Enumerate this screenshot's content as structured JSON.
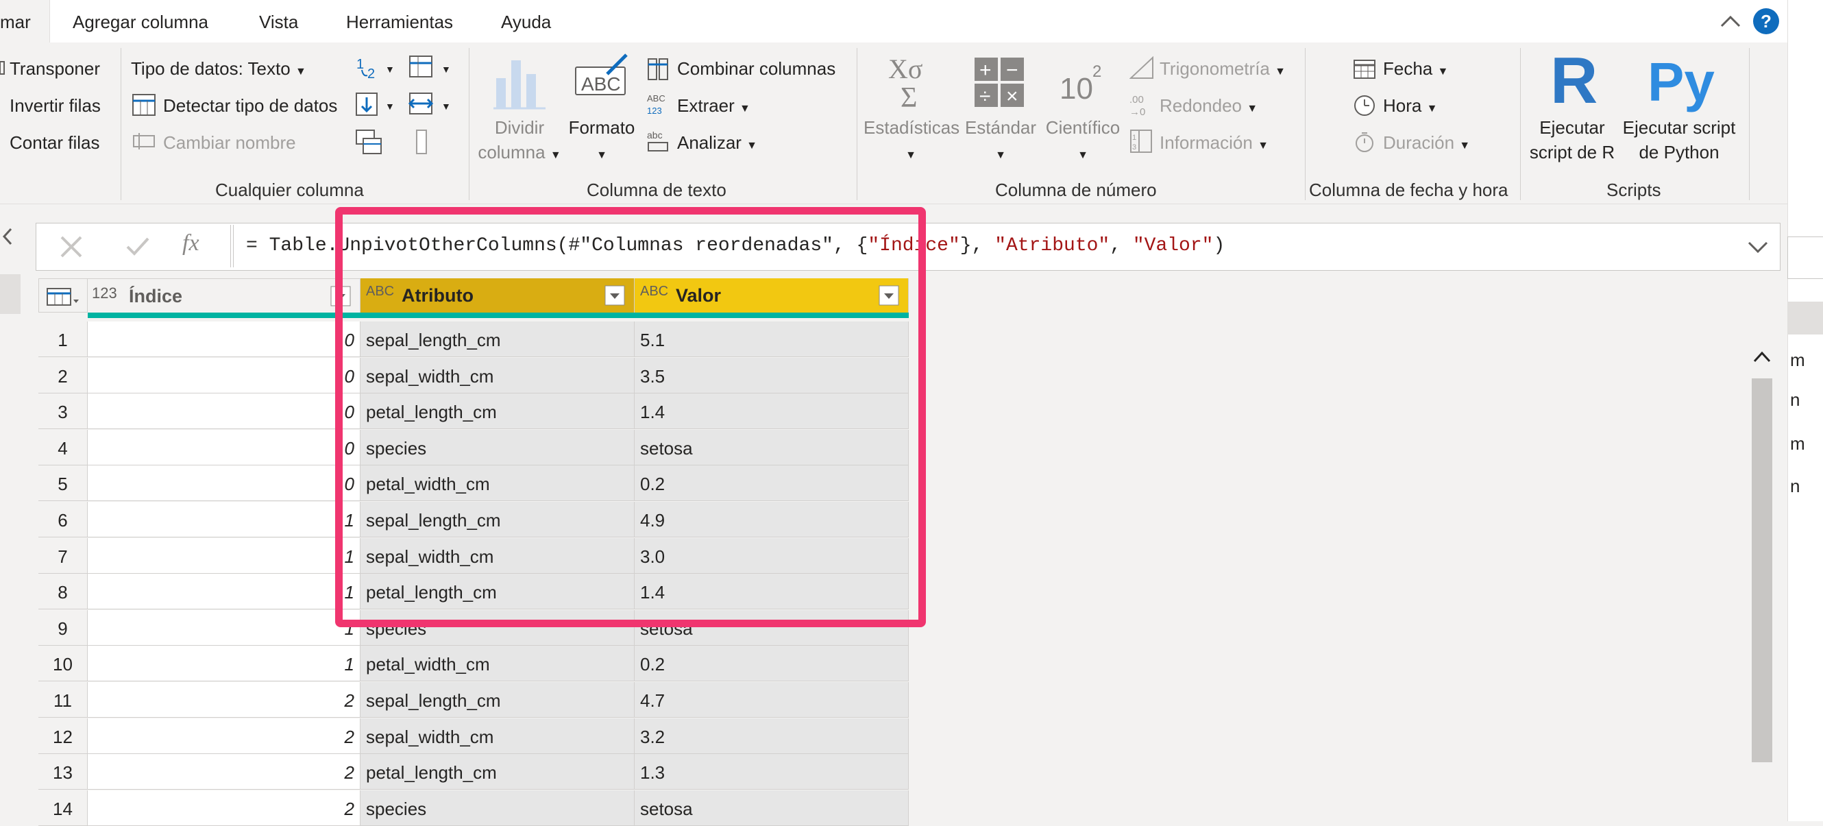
{
  "tabs": {
    "t0": "mar",
    "t1": "Agregar columna",
    "t2": "Vista",
    "t3": "Herramientas",
    "t4": "Ayuda"
  },
  "help_icon": "?",
  "ribbon": {
    "table_group": {
      "transpose": "Transponer",
      "reverse_rows": "Invertir filas",
      "count_rows": "Contar filas"
    },
    "any_column": {
      "data_type": "Tipo de datos: Texto",
      "detect_type": "Detectar tipo de datos",
      "rename": "Cambiar nombre",
      "label": "Cualquier columna"
    },
    "text_column": {
      "split": "Dividir",
      "split2": "columna",
      "format": "Formato",
      "merge": "Combinar columnas",
      "extract": "Extraer",
      "parse": "Analizar",
      "label": "Columna de texto"
    },
    "number_column": {
      "statistics": "Estadísticas",
      "standard": "Estándar",
      "scientific": "Científico",
      "trig": "Trigonometría",
      "rounding": "Redondeo",
      "info": "Información",
      "label": "Columna de número"
    },
    "datetime_column": {
      "date": "Fecha",
      "time": "Hora",
      "duration": "Duración",
      "label": "Columna de fecha y hora"
    },
    "scripts": {
      "r_line1": "Ejecutar",
      "r_line2": "script de R",
      "py_line1": "Ejecutar script",
      "py_line2": "de Python",
      "label": "Scripts"
    }
  },
  "formula_bar": {
    "fx": "fx",
    "p1": "= Table.UnpivotOtherColumns(#\"Columnas reordenadas\", {",
    "p2": "\"Índice\"",
    "p3": "}, ",
    "p4": "\"Atributo\"",
    "p5": ", ",
    "p6": "\"Valor\"",
    "p7": ")"
  },
  "columns": {
    "index": {
      "type": "123",
      "name": "Índice"
    },
    "attr": {
      "type": "ABC",
      "name": "Atributo"
    },
    "value": {
      "type": "ABC",
      "name": "Valor"
    }
  },
  "rows": [
    {
      "n": "1",
      "idx": "0",
      "attr": "sepal_length_cm",
      "val": "5.1"
    },
    {
      "n": "2",
      "idx": "0",
      "attr": "sepal_width_cm",
      "val": "3.5"
    },
    {
      "n": "3",
      "idx": "0",
      "attr": "petal_length_cm",
      "val": "1.4"
    },
    {
      "n": "4",
      "idx": "0",
      "attr": "species",
      "val": "setosa"
    },
    {
      "n": "5",
      "idx": "0",
      "attr": "petal_width_cm",
      "val": "0.2"
    },
    {
      "n": "6",
      "idx": "1",
      "attr": "sepal_length_cm",
      "val": "4.9"
    },
    {
      "n": "7",
      "idx": "1",
      "attr": "sepal_width_cm",
      "val": "3.0"
    },
    {
      "n": "8",
      "idx": "1",
      "attr": "petal_length_cm",
      "val": "1.4"
    },
    {
      "n": "9",
      "idx": "1",
      "attr": "species",
      "val": "setosa"
    },
    {
      "n": "10",
      "idx": "1",
      "attr": "petal_width_cm",
      "val": "0.2"
    },
    {
      "n": "11",
      "idx": "2",
      "attr": "sepal_length_cm",
      "val": "4.7"
    },
    {
      "n": "12",
      "idx": "2",
      "attr": "sepal_width_cm",
      "val": "3.2"
    },
    {
      "n": "13",
      "idx": "2",
      "attr": "petal_length_cm",
      "val": "1.3"
    },
    {
      "n": "14",
      "idx": "2",
      "attr": "species",
      "val": "setosa"
    }
  ],
  "right_pane_fragments": {
    "f1": "m",
    "f2": "n",
    "f3": "m",
    "f4": "n"
  },
  "colors": {
    "highlight": "#f0356f",
    "attr_header": "#d9ad12",
    "value_header": "#f2c811",
    "accent": "#0f6cbd"
  }
}
